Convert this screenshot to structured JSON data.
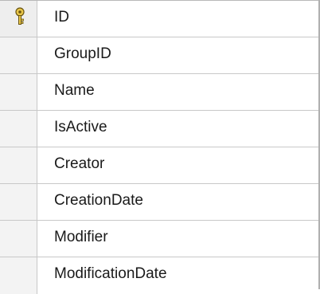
{
  "table": {
    "rows": [
      {
        "column_name": "ID",
        "is_primary_key": true
      },
      {
        "column_name": "GroupID",
        "is_primary_key": false
      },
      {
        "column_name": "Name",
        "is_primary_key": false
      },
      {
        "column_name": "IsActive",
        "is_primary_key": false
      },
      {
        "column_name": "Creator",
        "is_primary_key": false
      },
      {
        "column_name": "CreationDate",
        "is_primary_key": false
      },
      {
        "column_name": "Modifier",
        "is_primary_key": false
      },
      {
        "column_name": "ModificationDate",
        "is_primary_key": false
      }
    ]
  },
  "icons": {
    "primary_key": "key-icon"
  },
  "colors": {
    "key_gold": "#d8b43a",
    "selector_bg": "#f3f3f3",
    "grid_line": "#c8c8c8"
  }
}
